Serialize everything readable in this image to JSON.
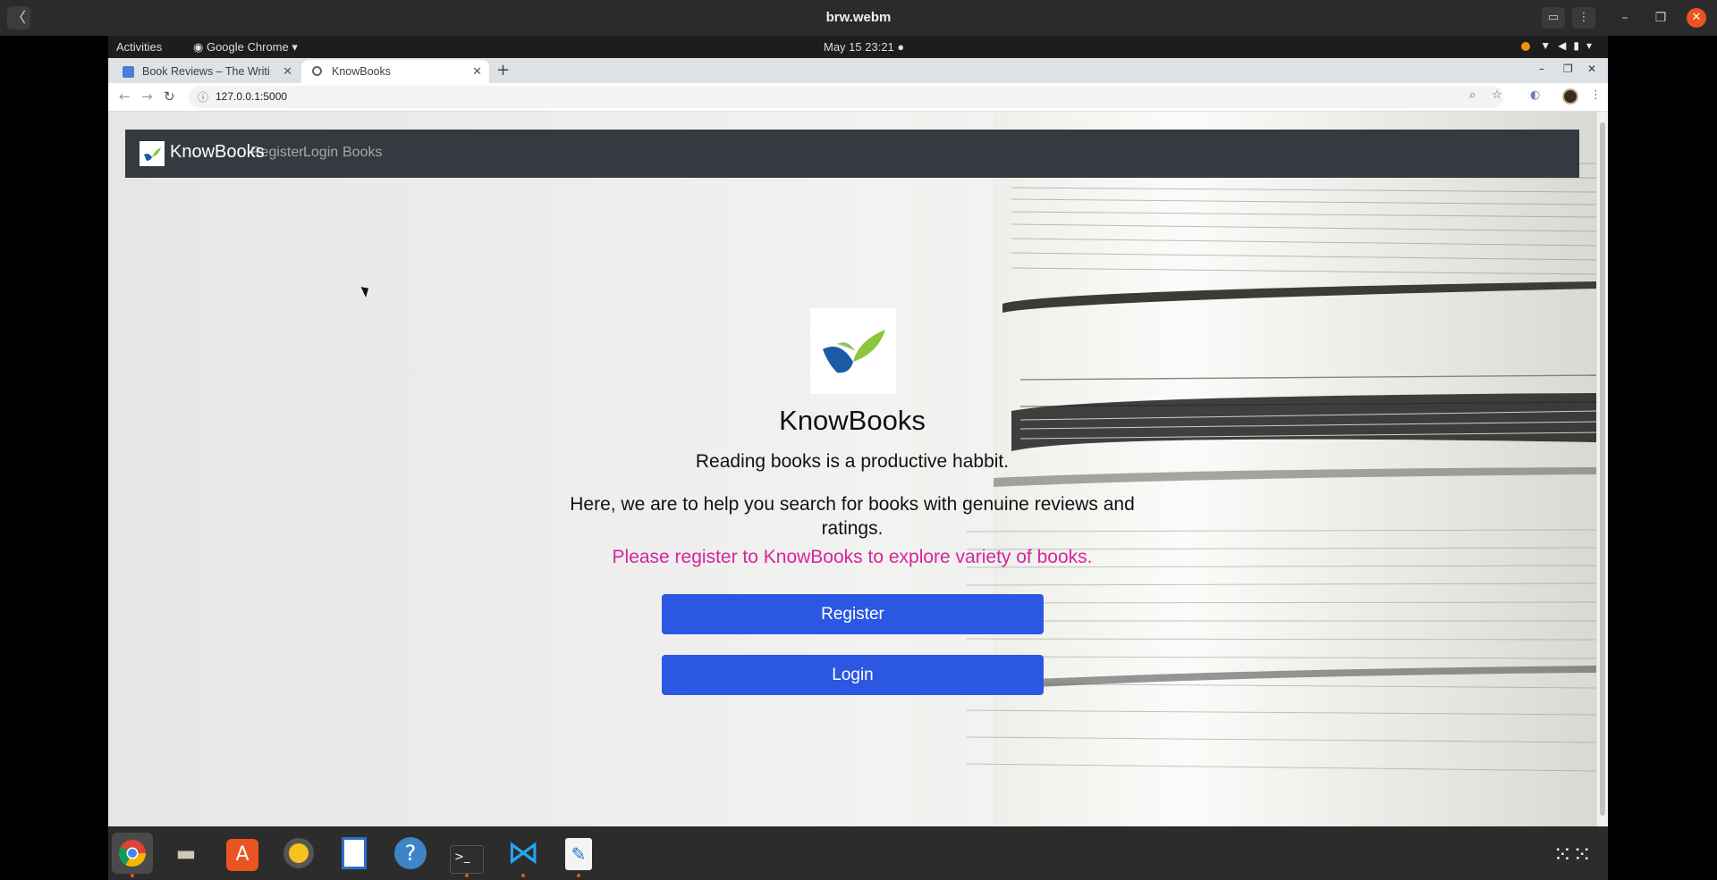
{
  "player": {
    "title": "brw.webm",
    "back_glyph": "〈"
  },
  "topbar": {
    "activities": "Activities",
    "app_menu": "Google Chrome ▾",
    "clock": "May 15  23:21"
  },
  "chrome": {
    "tabs": [
      {
        "label": "Book Reviews – The Writi",
        "favicon": "doc-icon",
        "active": false
      },
      {
        "label": "KnowBooks",
        "favicon": "globe-icon",
        "active": true
      }
    ],
    "address": "127.0.0.1:5000"
  },
  "page": {
    "navbar": {
      "brand": "KnowBooks",
      "links": [
        "Register",
        "Login",
        "Books"
      ]
    },
    "hero": {
      "title": "KnowBooks",
      "tagline": "Reading books is a productive habbit.",
      "description": "Here, we are to help you search for books with genuine reviews and ratings.",
      "cta": "Please register to KnowBooks to explore variety of books.",
      "register_button": "Register",
      "login_button": "Login"
    },
    "colors": {
      "navbar": "#343a40",
      "button": "#2b57e3",
      "cta": "#d6249f"
    }
  },
  "dock": {
    "items": [
      "chrome-icon",
      "files-icon",
      "software-icon",
      "rhythmbox-icon",
      "writer-icon",
      "help-icon",
      "terminal-icon",
      "vscode-icon",
      "text-editor-icon"
    ]
  }
}
